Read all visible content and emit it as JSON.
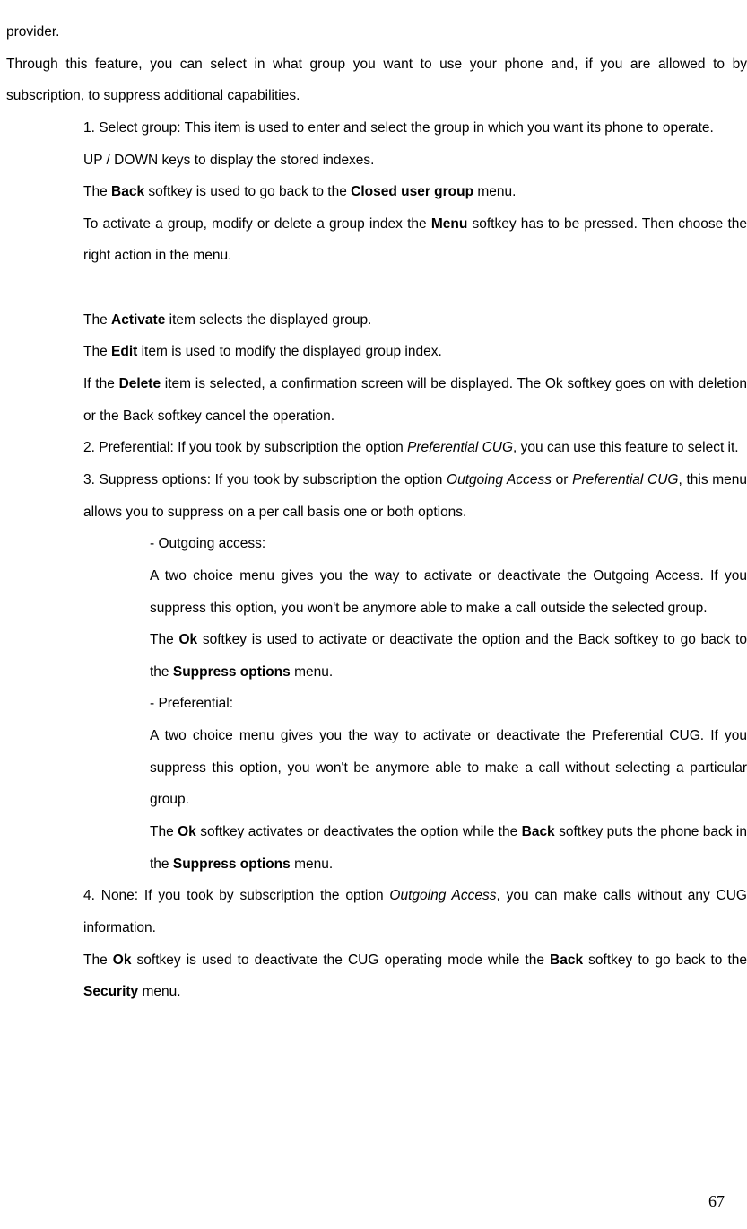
{
  "p1": "provider.",
  "p2": "Through this feature, you can select in what group you want to use your phone and, if you are allowed to by subscription, to suppress additional capabilities.",
  "p3": "1. Select group: This item is used to enter and select the group in which you want its phone to operate.",
  "p4": "UP / DOWN keys to display the stored indexes.",
  "p5_a": "The ",
  "p5_b": "Back",
  "p5_c": " softkey is used to go back to the ",
  "p5_d": "Closed user group",
  "p5_e": " menu.",
  "p6_a": "To activate a group, modify or delete a group index the ",
  "p6_b": "Menu",
  "p6_c": " softkey has to be pressed. Then choose the right action in the menu.",
  "p8_a": "The ",
  "p8_b": "Activate",
  "p8_c": " item selects the displayed group.",
  "p9_a": "The ",
  "p9_b": "Edit",
  "p9_c": " item is used to modify the displayed group index.",
  "p10_a": "If the ",
  "p10_b": "Delete",
  "p10_c": " item is selected, a confirmation screen will be displayed. The Ok softkey goes on with deletion or the Back softkey cancel the operation.",
  "p11_a": "2. Preferential: If you took by subscription the option ",
  "p11_b": "Preferential CUG",
  "p11_c": ", you can use this feature to select it.",
  "p12_a": "3. Suppress options: If you took by subscription the option ",
  "p12_b": "Outgoing Access",
  "p12_c": " or ",
  "p12_d": "Preferential CUG",
  "p12_e": ", this menu allows you to suppress on a per call basis one or both options.",
  "p13": "- Outgoing access:",
  "p14": "A two choice menu gives you the way to activate or deactivate the Outgoing Access. If you suppress this option, you won't be anymore able to make a call outside the selected group.",
  "p15_a": "The ",
  "p15_b": "Ok",
  "p15_c": " softkey is used to activate or deactivate the option and the Back softkey to go back to the ",
  "p15_d": "Suppress options",
  "p15_e": " menu.",
  "p16": "- Preferential:",
  "p17": "A two choice menu gives you the way to activate or deactivate the Preferential CUG. If you suppress this option, you won't be anymore able to make a call without selecting a particular group.",
  "p18_a": "The ",
  "p18_b": "Ok",
  "p18_c": " softkey activates or deactivates the option while the ",
  "p18_d": "Back",
  "p18_e": " softkey puts the phone back in the ",
  "p18_f": "Suppress options",
  "p18_g": " menu.",
  "p19_a": "4. None: If you took by subscription the option ",
  "p19_b": "Outgoing Access",
  "p19_c": ", you can make calls without any CUG information.",
  "p20_a": "The ",
  "p20_b": "Ok",
  "p20_c": " softkey is used to deactivate the CUG operating mode while the ",
  "p20_d": "Back",
  "p20_e": " softkey to go back to the ",
  "p20_f": "Security",
  "p20_g": " menu.",
  "page_number": "67"
}
